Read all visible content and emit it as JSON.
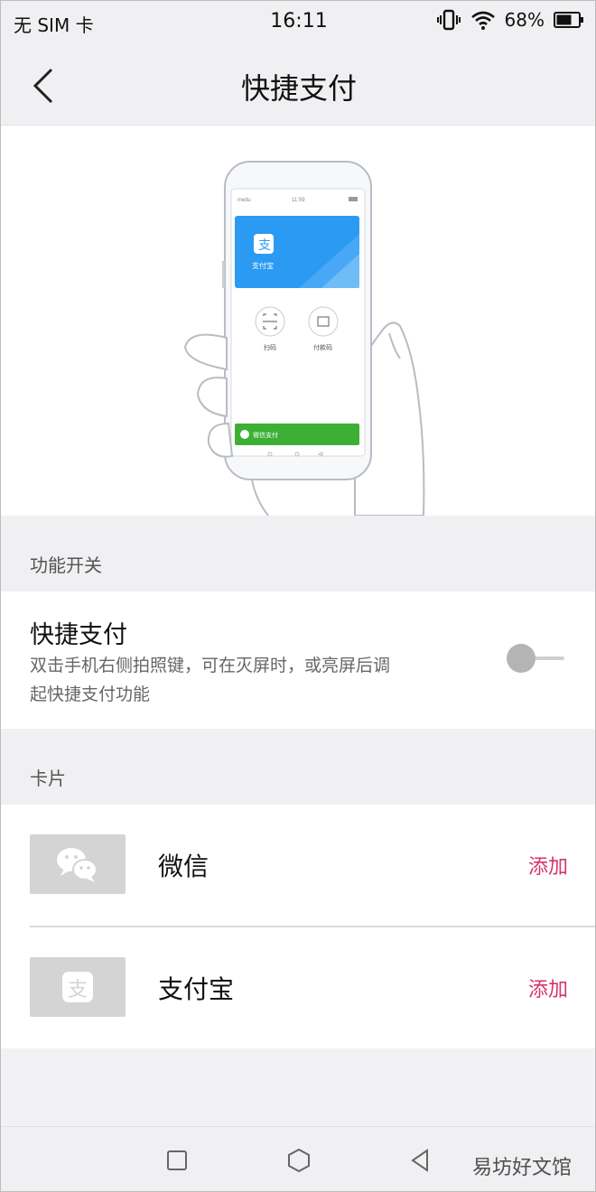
{
  "status_bar": {
    "carrier": "无 SIM 卡",
    "time": "16:11",
    "battery": "68%",
    "icons": [
      "vibrate-icon",
      "wifi-icon",
      "battery-icon"
    ]
  },
  "header": {
    "title": "快捷支付",
    "back_icon": "chevron-left-icon"
  },
  "illustration": {
    "phone_status_left": "meitu",
    "phone_status_time": "11:59",
    "alipay_card_label": "支付宝",
    "scan_label": "扫码",
    "paycode_label": "付款码",
    "wechat_bar_label": "微信支付"
  },
  "section_feature": {
    "label": "功能开关"
  },
  "quick_pay": {
    "title": "快捷支付",
    "description": "双击手机右侧拍照键，可在灭屏时，或亮屏后调起快捷支付功能",
    "enabled": false
  },
  "section_cards": {
    "label": "卡片"
  },
  "cards": [
    {
      "name": "微信",
      "action": "添加",
      "icon": "wechat-icon"
    },
    {
      "name": "支付宝",
      "action": "添加",
      "icon": "alipay-icon"
    }
  ],
  "colors": {
    "accent": "#d6336f",
    "alipay_blue": "#2b9af3",
    "wechat_green": "#3cb034"
  },
  "watermark": "易坊好文馆"
}
